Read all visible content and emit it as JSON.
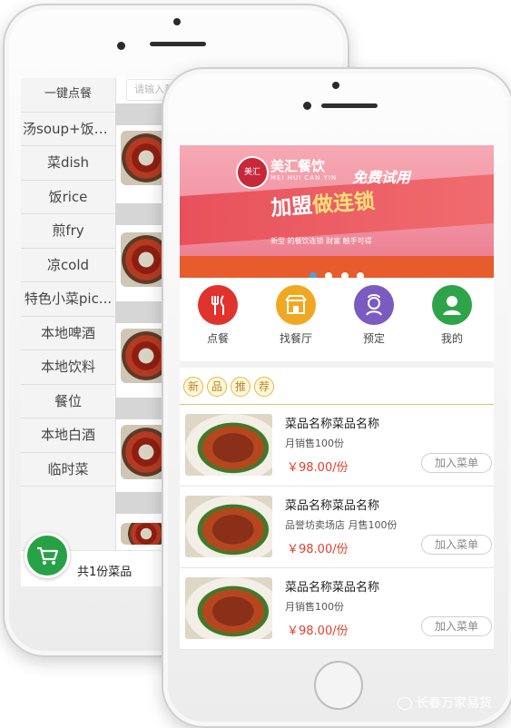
{
  "back_screen": {
    "search_placeholder": "请输入菜",
    "categories": [
      "一键点餐",
      "汤soup+饭+...",
      "菜dish",
      "饭rice",
      "煎fry",
      "凉cold",
      "特色小菜pic...",
      "本地啤酒",
      "本地饮料",
      "餐位",
      "本地白酒",
      "临时菜"
    ],
    "cart_summary": "共1份菜品",
    "cart_icon": "shopping-cart-icon"
  },
  "banner": {
    "logo_text": "美汇",
    "brand": "美汇餐饮",
    "brand_sub": "MEI HUI CAN YIN",
    "free_trial": "免费试用",
    "headline_part1": "加盟",
    "headline_part2": "做连锁",
    "tagline": "新型 的餐饮连锁  财富 触手可得",
    "slides": 4,
    "active_slide": 1
  },
  "quick_nav": [
    {
      "label": "点餐",
      "icon": "fork-knife-icon",
      "color": "#e0332e"
    },
    {
      "label": "找餐厅",
      "icon": "restaurant-icon",
      "color": "#f0a823"
    },
    {
      "label": "预定",
      "icon": "chef-icon",
      "color": "#7a5bbf"
    },
    {
      "label": "我的",
      "icon": "user-icon",
      "color": "#2fa34a"
    }
  ],
  "section_title_chars": [
    "新",
    "品",
    "推",
    "荐"
  ],
  "menu_items": [
    {
      "name": "菜品名称菜品名称",
      "sales": "月销售100份",
      "price": "￥98.00/份",
      "add_label": "加入菜单"
    },
    {
      "name": "菜品名称菜品名称",
      "sales": "品誉坊卖场店  月售100份",
      "price": "￥98.00/份",
      "add_label": "加入菜单"
    },
    {
      "name": "菜品名称菜品名称",
      "sales": "月销售100份",
      "price": "￥98.00/份",
      "add_label": "加入菜单"
    }
  ],
  "watermark": "长春万家易货",
  "colors": {
    "accent_red": "#e2402b",
    "cart_green": "#27a145",
    "gold": "#e3c36b"
  }
}
